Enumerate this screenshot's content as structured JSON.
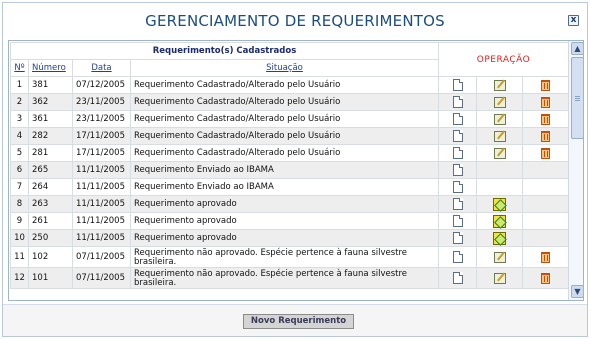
{
  "dialog": {
    "title": "GERENCIAMENTO DE REQUERIMENTOS",
    "close_label": "x"
  },
  "table": {
    "caption": "Requerimento(s) Cadastrados",
    "operation_header": "OPERAÇÃO",
    "columns": [
      "Nº",
      "Número",
      "Data",
      "Situação"
    ],
    "rows": [
      {
        "n": "1",
        "numero": "381",
        "data": "07/12/2005",
        "situacao": "Requerimento Cadastrado/Alterado pelo Usuário",
        "ops": [
          "view-icon",
          "edit-icon",
          "delete-icon"
        ]
      },
      {
        "n": "2",
        "numero": "362",
        "data": "23/11/2005",
        "situacao": "Requerimento Cadastrado/Alterado pelo Usuário",
        "ops": [
          "view-icon",
          "edit-icon",
          "delete-icon"
        ]
      },
      {
        "n": "3",
        "numero": "361",
        "data": "23/11/2005",
        "situacao": "Requerimento Cadastrado/Alterado pelo Usuário",
        "ops": [
          "view-icon",
          "edit-icon",
          "delete-icon"
        ]
      },
      {
        "n": "4",
        "numero": "282",
        "data": "17/11/2005",
        "situacao": "Requerimento Cadastrado/Alterado pelo Usuário",
        "ops": [
          "view-icon",
          "edit-icon",
          "delete-icon"
        ]
      },
      {
        "n": "5",
        "numero": "281",
        "data": "17/11/2005",
        "situacao": "Requerimento Cadastrado/Alterado pelo Usuário",
        "ops": [
          "view-icon",
          "edit-icon",
          "delete-icon"
        ]
      },
      {
        "n": "6",
        "numero": "265",
        "data": "11/11/2005",
        "situacao": "Requerimento Enviado ao IBAMA",
        "ops": [
          "view-icon"
        ]
      },
      {
        "n": "7",
        "numero": "264",
        "data": "11/11/2005",
        "situacao": "Requerimento Enviado ao IBAMA",
        "ops": [
          "view-icon"
        ]
      },
      {
        "n": "8",
        "numero": "263",
        "data": "11/11/2005",
        "situacao": "Requerimento aprovado",
        "ops": [
          "view-icon",
          "payment-icon"
        ]
      },
      {
        "n": "9",
        "numero": "261",
        "data": "11/11/2005",
        "situacao": "Requerimento aprovado",
        "ops": [
          "view-icon",
          "payment-icon"
        ]
      },
      {
        "n": "10",
        "numero": "250",
        "data": "11/11/2005",
        "situacao": "Requerimento aprovado",
        "ops": [
          "view-icon",
          "payment-icon"
        ]
      },
      {
        "n": "11",
        "numero": "102",
        "data": "07/11/2005",
        "situacao": "Requerimento não aprovado. Espécie pertence à fauna silvestre brasileira.",
        "ops": [
          "view-icon",
          "edit-icon",
          "delete-icon"
        ]
      },
      {
        "n": "12",
        "numero": "101",
        "data": "07/11/2005",
        "situacao": "Requerimento não aprovado. Espécie pertence à fauna silvestre brasileira.",
        "ops": [
          "view-icon",
          "edit-icon",
          "delete-icon"
        ]
      }
    ]
  },
  "footer": {
    "new_button_label": "Novo Requerimento"
  },
  "colors": {
    "title": "#1c4d82",
    "operation_header": "#e02020",
    "link": "#1f3fa0",
    "row_alt": "#eeeeee"
  }
}
